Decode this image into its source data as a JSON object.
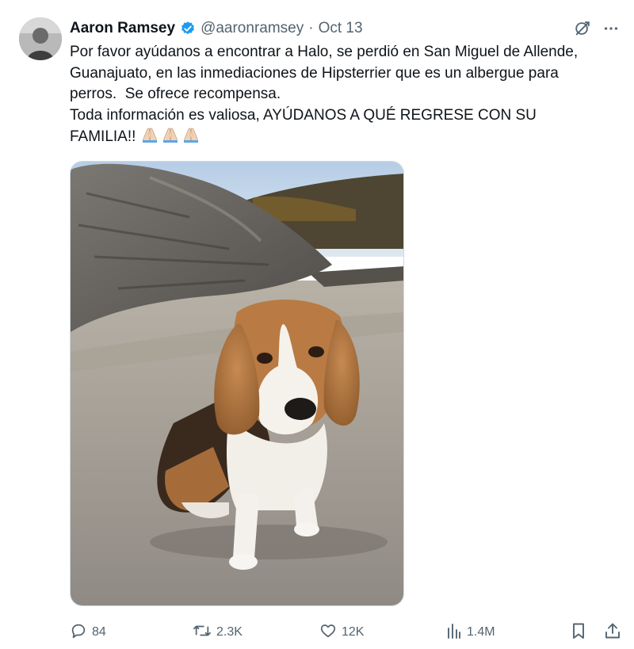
{
  "author": {
    "name": "Aaron Ramsey",
    "handle": "@aaronramsey",
    "separator": "·",
    "date": "Oct 13",
    "verified": true
  },
  "tweet": {
    "text": "Por favor ayúdanos a encontrar a Halo, se perdió en San Miguel de Allende,\nGuanajuato, en las inmediaciones de Hipsterrier que es un albergue para\nperros.  Se ofrece recompensa.\nToda información es valiosa, AYÚDANOS A QUÉ REGRESE CON SU\nFAMILIA!!",
    "emojis": [
      "folded-hands",
      "folded-hands",
      "folded-hands"
    ]
  },
  "media": {
    "subject": "beagle dog sitting on beach sand"
  },
  "metrics": {
    "replies": "84",
    "reposts": "2.3K",
    "likes": "12K",
    "views": "1.4M"
  },
  "colors": {
    "text": "#0f1419",
    "muted": "#536471",
    "verified": "#1d9bf0",
    "border": "#cfd9de"
  },
  "icons": {
    "verified": "verified-badge-icon",
    "grok": "grok-icon",
    "more": "more-icon",
    "reply": "reply-icon",
    "repost": "repost-icon",
    "like": "like-icon",
    "views": "views-icon",
    "bookmark": "bookmark-icon",
    "share": "share-icon"
  }
}
